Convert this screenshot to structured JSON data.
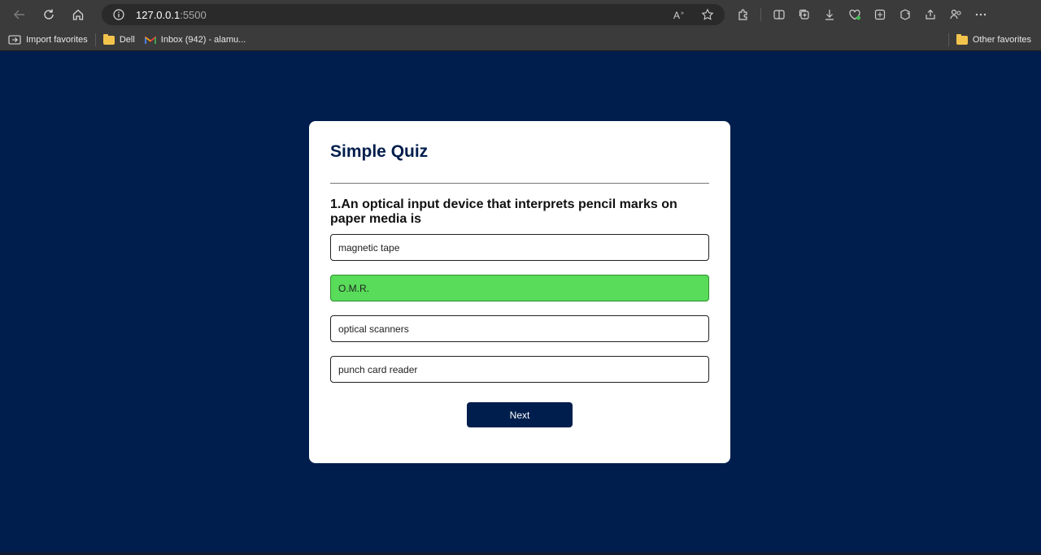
{
  "browser": {
    "url_host": "127.0.0.1",
    "url_port": ":5500",
    "favorites": [
      {
        "label": "Import favorites",
        "icon": "import-icon"
      },
      {
        "label": "Dell",
        "icon": "folder-icon"
      },
      {
        "label": "Inbox (942) - alamu...",
        "icon": "gmail-icon"
      }
    ],
    "other_favorites": "Other favorites"
  },
  "quiz": {
    "title": "Simple Quiz",
    "question": "1.An optical input device that interprets pencil marks on paper media is",
    "answers": [
      {
        "label": "magnetic tape",
        "state": "default"
      },
      {
        "label": "O.M.R.",
        "state": "correct"
      },
      {
        "label": "optical scanners",
        "state": "default"
      },
      {
        "label": "punch card reader",
        "state": "default"
      }
    ],
    "next_label": "Next"
  },
  "colors": {
    "page_background": "#001e4d",
    "correct_answer": "#58dc5a",
    "card": "#ffffff"
  }
}
